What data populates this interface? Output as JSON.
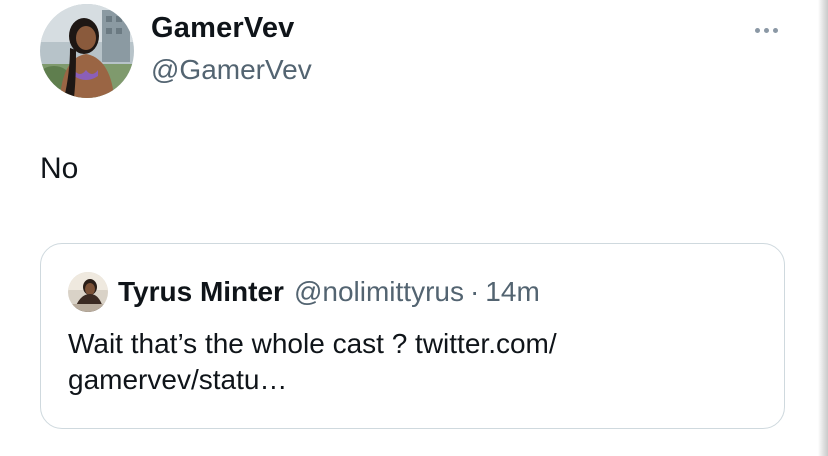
{
  "tweet": {
    "author": {
      "name": "GamerVev",
      "handle": "@GamerVev"
    },
    "text": "No",
    "more_icon": "more-horizontal-icon"
  },
  "quote": {
    "author": {
      "name": "Tyrus Minter",
      "handle": "@nolimittyrus"
    },
    "separator": "·",
    "time": "14m",
    "text_lines": [
      "Wait that’s the whole cast ? twitter.com/",
      "gamervev/statu…"
    ]
  },
  "colors": {
    "text_primary": "#0f1419",
    "text_secondary": "#536471",
    "border": "#cfd9de"
  }
}
